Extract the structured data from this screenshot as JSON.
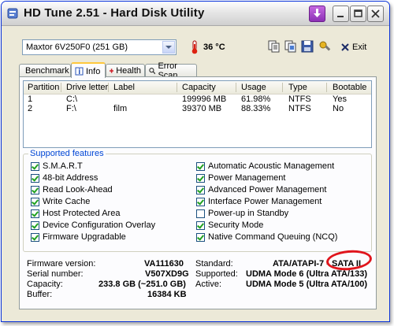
{
  "window": {
    "title": "HD Tune 2.51 - Hard Disk Utility",
    "buttons": {
      "download": "download-icon",
      "minimize": "minimize-icon",
      "maximize": "maximize-icon",
      "close": "close-icon"
    }
  },
  "toolbar": {
    "drive_selected": "Maxtor 6V250F0 (251 GB)",
    "temperature": "36 °C",
    "exit_label": "Exit",
    "icons": [
      "copy-text-icon",
      "copy-screenshot-icon",
      "save-icon",
      "options-icon"
    ]
  },
  "tabs": [
    {
      "label": "Benchmark",
      "icon": "benchmark-icon",
      "active": false
    },
    {
      "label": "Info",
      "icon": "info-icon",
      "active": true
    },
    {
      "label": "Health",
      "icon": "health-icon",
      "active": false
    },
    {
      "label": "Error Scan",
      "icon": "search-icon",
      "active": false
    }
  ],
  "partitions": {
    "columns": [
      "Partition",
      "Drive letter",
      "Label",
      "Capacity",
      "Usage",
      "Type",
      "Bootable"
    ],
    "rows": [
      [
        "1",
        "C:\\",
        "",
        "199996 MB",
        "61.98%",
        "NTFS",
        "Yes"
      ],
      [
        "2",
        "F:\\",
        "film",
        "39370 MB",
        "88.33%",
        "NTFS",
        "No"
      ]
    ]
  },
  "features": {
    "legend": "Supported features",
    "left": [
      {
        "label": "S.M.A.R.T",
        "checked": true
      },
      {
        "label": "48-bit Address",
        "checked": true
      },
      {
        "label": "Read Look-Ahead",
        "checked": true
      },
      {
        "label": "Write Cache",
        "checked": true
      },
      {
        "label": "Host Protected Area",
        "checked": true
      },
      {
        "label": "Device Configuration Overlay",
        "checked": true
      },
      {
        "label": "Firmware Upgradable",
        "checked": true
      }
    ],
    "right": [
      {
        "label": "Automatic Acoustic Management",
        "checked": true
      },
      {
        "label": "Power Management",
        "checked": true
      },
      {
        "label": "Advanced Power Management",
        "checked": true
      },
      {
        "label": "Interface Power Management",
        "checked": true
      },
      {
        "label": "Power-up in Standby",
        "checked": false
      },
      {
        "label": "Security Mode",
        "checked": true
      },
      {
        "label": "Native Command Queuing (NCQ)",
        "checked": true
      }
    ]
  },
  "info": {
    "firmware_label": "Firmware version:",
    "firmware": "VA111630",
    "serial_label": "Serial number:",
    "serial": "V507XD9G",
    "capacity_label": "Capacity:",
    "capacity": "233.8 GB (~251.0 GB)",
    "buffer_label": "Buffer:",
    "buffer": "16384 KB",
    "standard_label": "Standard:",
    "standard": "ATA/ATAPI-7 - SATA II",
    "supported_label": "Supported:",
    "supported": "UDMA Mode 6 (Ultra ATA/133)",
    "active_label": "Active:",
    "active": "UDMA Mode 5 (Ultra ATA/100)"
  },
  "colors": {
    "legend": "#0046d5",
    "annotation_circle": "#e0151c",
    "tab_highlight": "#ffc83c"
  }
}
